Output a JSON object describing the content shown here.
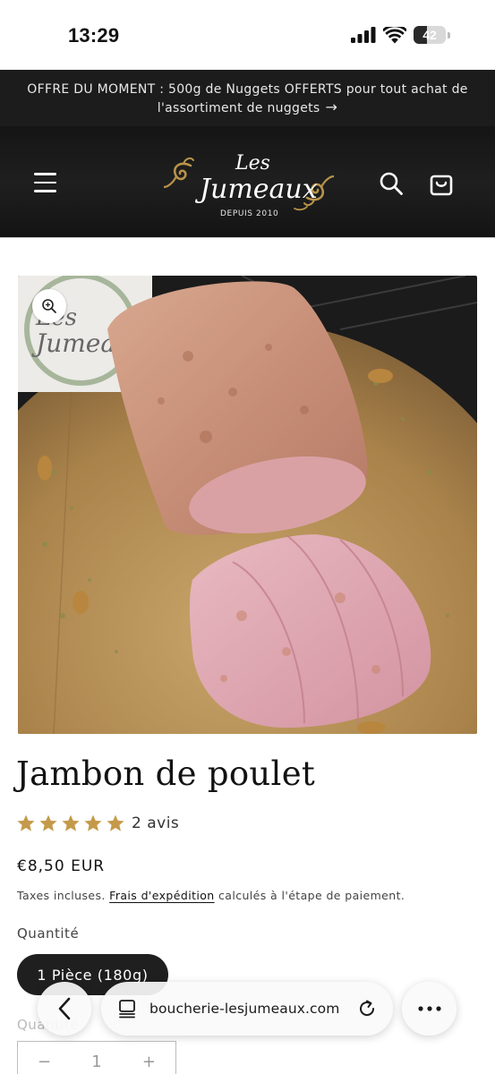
{
  "status_bar": {
    "time": "13:29",
    "battery_percent": 42,
    "battery_label": "42",
    "icons": [
      "signal-icon",
      "wifi-icon",
      "battery-icon"
    ]
  },
  "announcement": {
    "text": "OFFRE DU MOMENT : 500g de Nuggets OFFERTS pour tout achat de l'assortiment de nuggets",
    "arrow_icon": "arrow-right-icon"
  },
  "header": {
    "menu_icon": "hamburger-menu-icon",
    "logo": {
      "line1": "Les",
      "line2": "Jumeaux",
      "tagline": "DEPUIS 2010"
    },
    "search_icon": "search-icon",
    "cart_icon": "cart-icon"
  },
  "product": {
    "image_alt": "Jambon de poulet",
    "zoom_icon": "zoom-in-icon",
    "title": "Jambon de poulet",
    "rating": 5,
    "reviews": "2 avis",
    "price": "€8,50 EUR",
    "tax_prefix": "Taxes incluses.",
    "shipping_link": "Frais d'expédition",
    "tax_suffix": "calculés à l'étape de paiement.",
    "quantity_label": "Quantité",
    "variant": "1 Pièce (180g)",
    "quantity_label_2": "Quantité",
    "quantity_value": "1",
    "decrement": "−",
    "increment": "+"
  },
  "colors": {
    "header_bg": "#1c1c1c",
    "star": "#c49a4a",
    "logo_gold": "#b8934a"
  },
  "browser": {
    "url": "boucherie-lesjumeaux.com",
    "back_icon": "chevron-left-icon",
    "tabs_icon": "tabs-icon",
    "reload_icon": "reload-icon",
    "more_icon": "more-dots-icon"
  }
}
